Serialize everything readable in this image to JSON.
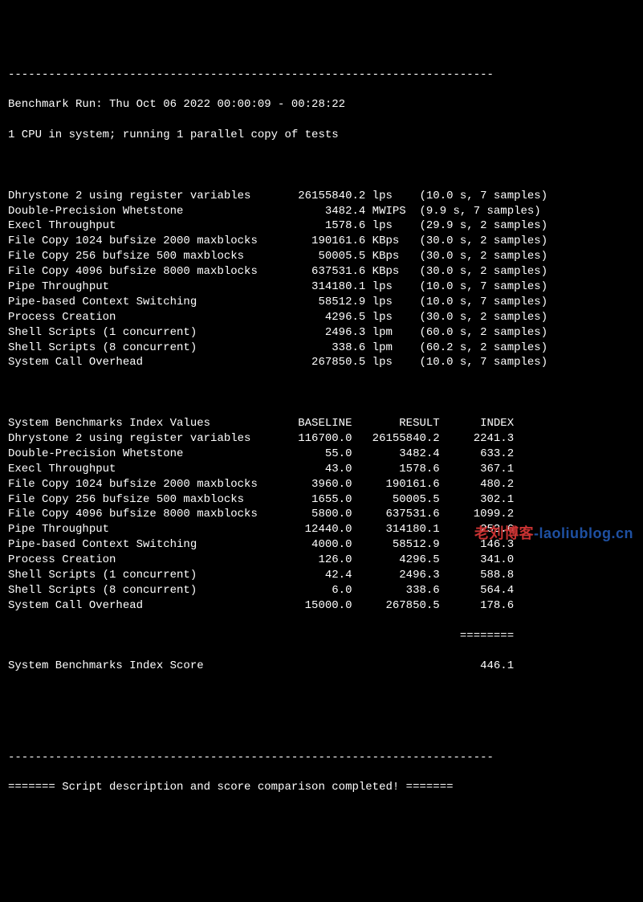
{
  "divider_top": "------------------------------------------------------------------------",
  "header": {
    "run_line": "Benchmark Run: Thu Oct 06 2022 00:00:09 - 00:28:22",
    "cpu_line": "1 CPU in system; running 1 parallel copy of tests"
  },
  "results": [
    {
      "name": "Dhrystone 2 using register variables",
      "value": "26155840.2",
      "unit": "lps",
      "note": "(10.0 s, 7 samples)"
    },
    {
      "name": "Double-Precision Whetstone",
      "value": "3482.4",
      "unit": "MWIPS",
      "note": "(9.9 s, 7 samples)"
    },
    {
      "name": "Execl Throughput",
      "value": "1578.6",
      "unit": "lps",
      "note": "(29.9 s, 2 samples)"
    },
    {
      "name": "File Copy 1024 bufsize 2000 maxblocks",
      "value": "190161.6",
      "unit": "KBps",
      "note": "(30.0 s, 2 samples)"
    },
    {
      "name": "File Copy 256 bufsize 500 maxblocks",
      "value": "50005.5",
      "unit": "KBps",
      "note": "(30.0 s, 2 samples)"
    },
    {
      "name": "File Copy 4096 bufsize 8000 maxblocks",
      "value": "637531.6",
      "unit": "KBps",
      "note": "(30.0 s, 2 samples)"
    },
    {
      "name": "Pipe Throughput",
      "value": "314180.1",
      "unit": "lps",
      "note": "(10.0 s, 7 samples)"
    },
    {
      "name": "Pipe-based Context Switching",
      "value": "58512.9",
      "unit": "lps",
      "note": "(10.0 s, 7 samples)"
    },
    {
      "name": "Process Creation",
      "value": "4296.5",
      "unit": "lps",
      "note": "(30.0 s, 2 samples)"
    },
    {
      "name": "Shell Scripts (1 concurrent)",
      "value": "2496.3",
      "unit": "lpm",
      "note": "(60.0 s, 2 samples)"
    },
    {
      "name": "Shell Scripts (8 concurrent)",
      "value": "338.6",
      "unit": "lpm",
      "note": "(60.2 s, 2 samples)"
    },
    {
      "name": "System Call Overhead",
      "value": "267850.5",
      "unit": "lps",
      "note": "(10.0 s, 7 samples)"
    }
  ],
  "index_header": {
    "title": "System Benchmarks Index Values",
    "c1": "BASELINE",
    "c2": "RESULT",
    "c3": "INDEX"
  },
  "index_rows": [
    {
      "name": "Dhrystone 2 using register variables",
      "baseline": "116700.0",
      "result": "26155840.2",
      "index": "2241.3"
    },
    {
      "name": "Double-Precision Whetstone",
      "baseline": "55.0",
      "result": "3482.4",
      "index": "633.2"
    },
    {
      "name": "Execl Throughput",
      "baseline": "43.0",
      "result": "1578.6",
      "index": "367.1"
    },
    {
      "name": "File Copy 1024 bufsize 2000 maxblocks",
      "baseline": "3960.0",
      "result": "190161.6",
      "index": "480.2"
    },
    {
      "name": "File Copy 256 bufsize 500 maxblocks",
      "baseline": "1655.0",
      "result": "50005.5",
      "index": "302.1"
    },
    {
      "name": "File Copy 4096 bufsize 8000 maxblocks",
      "baseline": "5800.0",
      "result": "637531.6",
      "index": "1099.2"
    },
    {
      "name": "Pipe Throughput",
      "baseline": "12440.0",
      "result": "314180.1",
      "index": "252.6"
    },
    {
      "name": "Pipe-based Context Switching",
      "baseline": "4000.0",
      "result": "58512.9",
      "index": "146.3"
    },
    {
      "name": "Process Creation",
      "baseline": "126.0",
      "result": "4296.5",
      "index": "341.0"
    },
    {
      "name": "Shell Scripts (1 concurrent)",
      "baseline": "42.4",
      "result": "2496.3",
      "index": "588.8"
    },
    {
      "name": "Shell Scripts (8 concurrent)",
      "baseline": "6.0",
      "result": "338.6",
      "index": "564.4"
    },
    {
      "name": "System Call Overhead",
      "baseline": "15000.0",
      "result": "267850.5",
      "index": "178.6"
    }
  ],
  "index_rule": "                                                                   ========",
  "index_score": {
    "label": "System Benchmarks Index Score",
    "value": "446.1"
  },
  "footer": {
    "divider": "------------------------------------------------------------------------",
    "msg": "======= Script description and score comparison completed! ======="
  },
  "watermark": {
    "red": "老刘博客",
    "blue": "-laoliublog.cn"
  }
}
